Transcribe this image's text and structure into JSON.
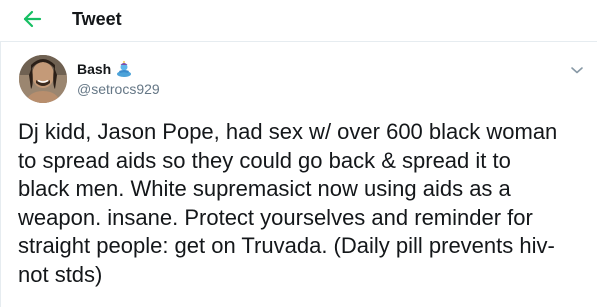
{
  "header": {
    "back_icon": "arrow-left-icon",
    "title": "Tweet",
    "accent_color": "#17bf63"
  },
  "tweet": {
    "author": {
      "display_name": "Bash",
      "name_emoji_icon": "genie-emoji-icon",
      "handle": "@setrocs929"
    },
    "menu_icon": "chevron-down-icon",
    "text_lines": [
      "Dj kidd, Jason Pope, had sex w/ over 600 black woman",
      "to spread aids so they could go back & spread it to",
      "black men. White supremasict now using aids as a",
      "weapon. insane. Protect yourselves and reminder for",
      "straight people: get on Truvada. (Daily pill prevents hiv-",
      "not stds)"
    ]
  }
}
